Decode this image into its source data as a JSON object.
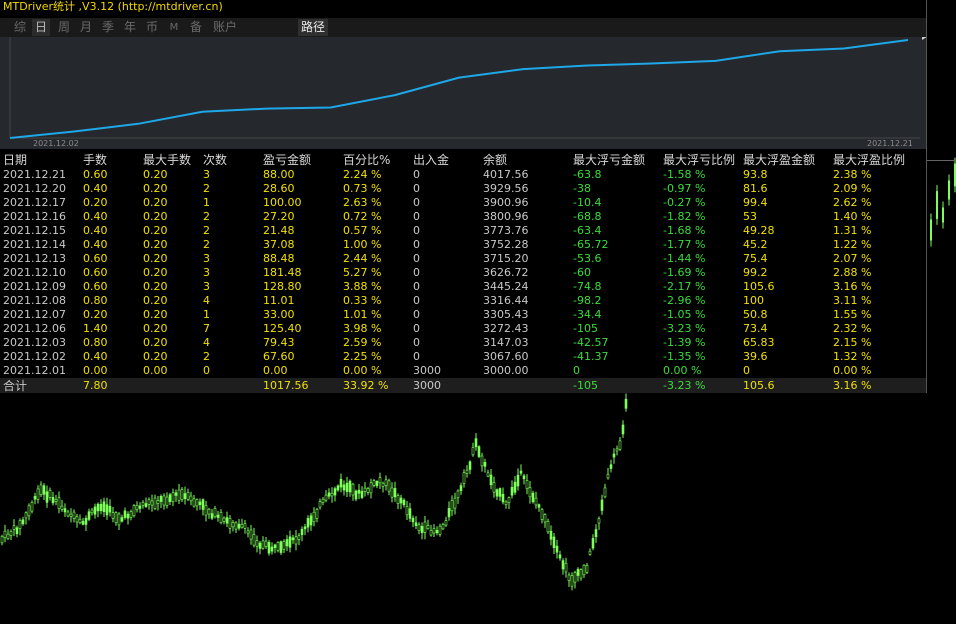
{
  "app": {
    "title": "MTDriver统计 ,V3.12 (http://mtdriver.cn)"
  },
  "tabs": [
    "综",
    "日",
    "周",
    "月",
    "季",
    "年",
    "币",
    "M",
    "备",
    "账户"
  ],
  "active_tab": "日",
  "path_tab": "路径",
  "curve": {
    "start_label": "2021.12.02",
    "end_label": "2021.12.21",
    "values": [
      3000.0,
      3067.6,
      3147.03,
      3272.43,
      3305.43,
      3316.44,
      3445.24,
      3626.72,
      3715.2,
      3752.28,
      3773.76,
      3800.96,
      3900.96,
      3929.56,
      4017.56
    ],
    "line_color": "#1fa8e8"
  },
  "columns": [
    "日期",
    "手数",
    "最大手数",
    "次数",
    "盈亏金额",
    "百分比%",
    "出入金",
    "余额",
    "最大浮亏金额",
    "最大浮亏比例",
    "最大浮盈金额",
    "最大浮盈比例"
  ],
  "rows": [
    [
      "2021.12.21",
      "0.60",
      "0.20",
      "3",
      "88.00",
      "2.24 %",
      "0",
      "4017.56",
      "-63.8",
      "-1.58 %",
      "93.8",
      "2.38 %"
    ],
    [
      "2021.12.20",
      "0.40",
      "0.20",
      "2",
      "28.60",
      "0.73 %",
      "0",
      "3929.56",
      "-38",
      "-0.97 %",
      "81.6",
      "2.09 %"
    ],
    [
      "2021.12.17",
      "0.20",
      "0.20",
      "1",
      "100.00",
      "2.63 %",
      "0",
      "3900.96",
      "-10.4",
      "-0.27 %",
      "99.4",
      "2.62 %"
    ],
    [
      "2021.12.16",
      "0.40",
      "0.20",
      "2",
      "27.20",
      "0.72 %",
      "0",
      "3800.96",
      "-68.8",
      "-1.82 %",
      "53",
      "1.40 %"
    ],
    [
      "2021.12.15",
      "0.40",
      "0.20",
      "2",
      "21.48",
      "0.57 %",
      "0",
      "3773.76",
      "-63.4",
      "-1.68 %",
      "49.28",
      "1.31 %"
    ],
    [
      "2021.12.14",
      "0.40",
      "0.20",
      "2",
      "37.08",
      "1.00 %",
      "0",
      "3752.28",
      "-65.72",
      "-1.77 %",
      "45.2",
      "1.22 %"
    ],
    [
      "2021.12.13",
      "0.60",
      "0.20",
      "3",
      "88.48",
      "2.44 %",
      "0",
      "3715.20",
      "-53.6",
      "-1.44 %",
      "75.4",
      "2.07 %"
    ],
    [
      "2021.12.10",
      "0.60",
      "0.20",
      "3",
      "181.48",
      "5.27 %",
      "0",
      "3626.72",
      "-60",
      "-1.69 %",
      "99.2",
      "2.88 %"
    ],
    [
      "2021.12.09",
      "0.60",
      "0.20",
      "3",
      "128.80",
      "3.88 %",
      "0",
      "3445.24",
      "-74.8",
      "-2.17 %",
      "105.6",
      "3.16 %"
    ],
    [
      "2021.12.08",
      "0.80",
      "0.20",
      "4",
      "11.01",
      "0.33 %",
      "0",
      "3316.44",
      "-98.2",
      "-2.96 %",
      "100",
      "3.11 %"
    ],
    [
      "2021.12.07",
      "0.20",
      "0.20",
      "1",
      "33.00",
      "1.01 %",
      "0",
      "3305.43",
      "-34.4",
      "-1.05 %",
      "50.8",
      "1.55 %"
    ],
    [
      "2021.12.06",
      "1.40",
      "0.20",
      "7",
      "125.40",
      "3.98 %",
      "0",
      "3272.43",
      "-105",
      "-3.23 %",
      "73.4",
      "2.32 %"
    ],
    [
      "2021.12.03",
      "0.80",
      "0.20",
      "4",
      "79.43",
      "2.59 %",
      "0",
      "3147.03",
      "-42.57",
      "-1.39 %",
      "65.83",
      "2.15 %"
    ],
    [
      "2021.12.02",
      "0.40",
      "0.20",
      "2",
      "67.60",
      "2.25 %",
      "0",
      "3067.60",
      "-41.37",
      "-1.35 %",
      "39.6",
      "1.32 %"
    ],
    [
      "2021.12.01",
      "0.00",
      "0.00",
      "0",
      "0.00",
      "0.00 %",
      "3000",
      "3000.00",
      "0",
      "0.00 %",
      "0",
      "0.00 %"
    ]
  ],
  "total": [
    "合计",
    "7.80",
    "",
    "",
    "1017.56",
    "33.92 %",
    "3000",
    "",
    "-105",
    "-3.23 %",
    "105.6",
    "3.16 %"
  ],
  "colors": {
    "title": "#f5d800",
    "value_yellow": "#f0e000",
    "value_green": "#3adc3a",
    "candle": "#7dff5a",
    "bg": "#000000"
  }
}
